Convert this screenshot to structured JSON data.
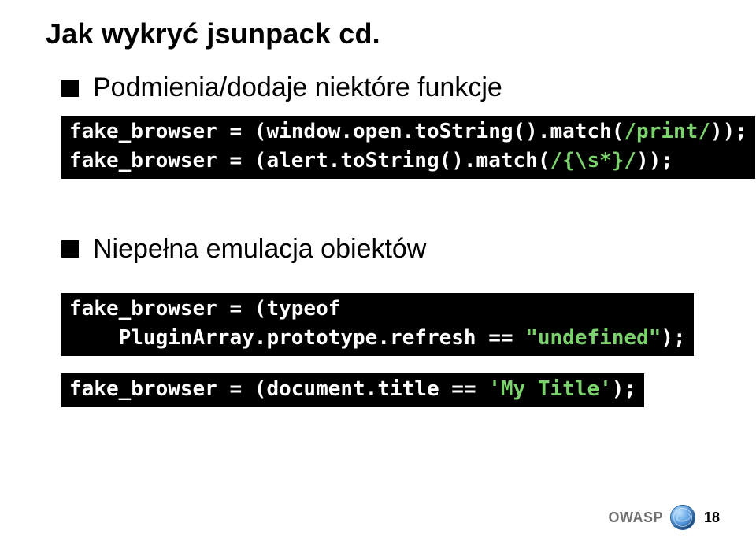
{
  "title": "Jak wykryć jsunpack cd.",
  "bullets": {
    "b1": "Podmienia/dodaje niektóre funkcje",
    "b2": "Niepełna emulacja obiektów"
  },
  "code1": {
    "line1_a": "fake_browser = (window.open.toString().match(",
    "line1_b": "/print/",
    "line1_c": "));",
    "line2_a": "fake_browser = (alert.toString().match(",
    "line2_b": "/{\\s*}/",
    "line2_c": "));"
  },
  "code2": {
    "line1": "fake_browser = (typeof",
    "line2_a": "    PluginArray.prototype.refresh == ",
    "line2_b": "\"undefined\"",
    "line2_c": ");"
  },
  "code3": {
    "line1_a": "fake_browser = (document.title == ",
    "line1_b": "'My Title'",
    "line1_c": ");"
  },
  "footer": {
    "brand": "OWASP",
    "page": "18"
  }
}
